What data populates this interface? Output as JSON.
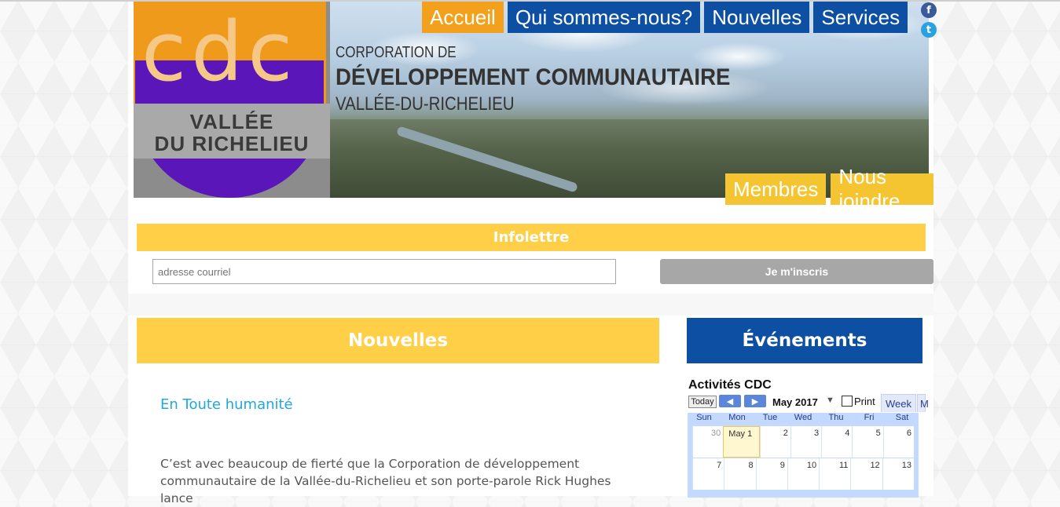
{
  "header": {
    "logo": {
      "big": "cdc",
      "line1": "VALLÉE",
      "line2": "DU RICHELIEU"
    },
    "org": {
      "line1": "CORPORATION DE",
      "line2": "DÉVELOPPEMENT COMMUNAUTAIRE",
      "line3": "VALLÉE-DU-RICHELIEU"
    },
    "nav_top": [
      "Accueil",
      "Qui sommes-nous?",
      "Nouvelles",
      "Services"
    ],
    "nav_bottom": [
      "Membres",
      "Nous joindre"
    ],
    "social": {
      "facebook": "f",
      "twitter": "t"
    }
  },
  "newsletter": {
    "title": "Infolettre",
    "placeholder": "adresse courriel",
    "button": "Je m'inscris"
  },
  "news": {
    "heading": "Nouvelles",
    "article_title": "En Toute humanité",
    "article_text": "C’est avec beaucoup de fierté que la Corporation de développement communautaire de la Vallée-du-Richelieu et son porte-parole Rick Hughes lance"
  },
  "events": {
    "heading": "Événements",
    "calendar_title": "Activités CDC",
    "today_btn": "Today",
    "month": "May 2017",
    "print": "Print",
    "tab_week": "Week",
    "tab_more": "M",
    "days": [
      "Sun",
      "Mon",
      "Tue",
      "Wed",
      "Thu",
      "Fri",
      "Sat"
    ],
    "row1": [
      "30",
      "May 1",
      "2",
      "3",
      "4",
      "5",
      "6"
    ],
    "row2": [
      "7",
      "8",
      "9",
      "10",
      "11",
      "12",
      "13"
    ]
  },
  "colors": {
    "orange": "#f3a11d",
    "blue": "#0d4fa3",
    "yellow": "#ffcf48",
    "link": "#20a8d8"
  }
}
